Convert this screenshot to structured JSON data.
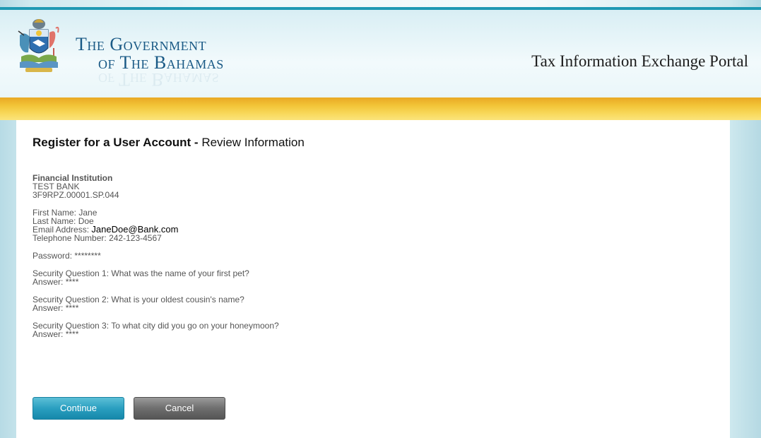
{
  "header": {
    "gov_line1": "The Government",
    "gov_line2": "of The Bahamas",
    "portal_title": "Tax Information Exchange Portal"
  },
  "heading": {
    "bold": "Register for a User Account -",
    "normal": "Review Information"
  },
  "institution": {
    "label": "Financial Institution",
    "name": "TEST BANK",
    "id": "3F9RPZ.00001.SP.044"
  },
  "contact": {
    "first_name_label": "First Name:",
    "first_name": "Jane",
    "last_name_label": "Last Name:",
    "last_name": "Doe",
    "email_label": "Email Address:",
    "email": "JaneDoe@Bank.com",
    "phone_label": "Telephone Number:",
    "phone": "242-123-4567"
  },
  "password": {
    "label": "Password:",
    "value": "********"
  },
  "security": [
    {
      "question_label": "Security Question 1:",
      "question": "What was the name of your first pet?",
      "answer_label": "Answer:",
      "answer": "****"
    },
    {
      "question_label": "Security Question 2:",
      "question": "What is your oldest cousin's name?",
      "answer_label": "Answer:",
      "answer": "****"
    },
    {
      "question_label": "Security Question 3:",
      "question": "To what city did you go on your honeymoon?",
      "answer_label": "Answer:",
      "answer": "****"
    }
  ],
  "buttons": {
    "continue": "Continue",
    "cancel": "Cancel"
  },
  "colors": {
    "accent": "#2a9fc0",
    "gold": "#f2c437",
    "title_blue": "#1a5a86"
  },
  "icons": {
    "logo": "coat-of-arms-icon"
  }
}
